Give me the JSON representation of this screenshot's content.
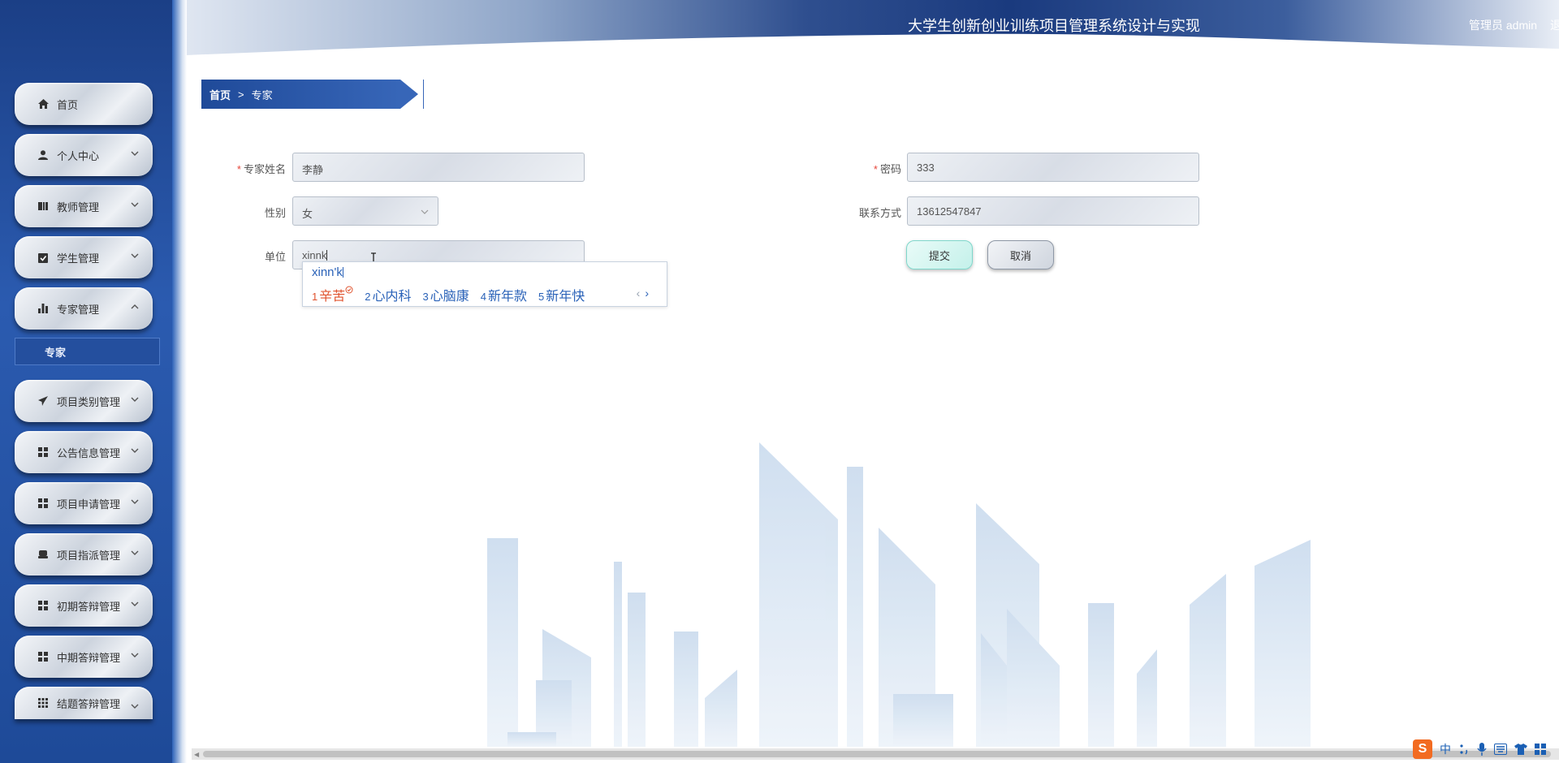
{
  "header": {
    "title": "大学生创新创业训练项目管理系统设计与实现",
    "admin_label": "管理员 admin",
    "logout": "退出登录"
  },
  "sidebar": {
    "items": [
      {
        "label": "首页",
        "icon": "home-icon",
        "chevron": false
      },
      {
        "label": "个人中心",
        "icon": "user-icon",
        "chevron": "down"
      },
      {
        "label": "教师管理",
        "icon": "book-icon",
        "chevron": "down"
      },
      {
        "label": "学生管理",
        "icon": "clipboard-check-icon",
        "chevron": "down"
      },
      {
        "label": "专家管理",
        "icon": "bar-chart-icon",
        "chevron": "up"
      },
      {
        "label": "项目类别管理",
        "icon": "paper-plane-icon",
        "chevron": "down"
      },
      {
        "label": "公告信息管理",
        "icon": "grid-icon",
        "chevron": "down"
      },
      {
        "label": "项目申请管理",
        "icon": "grid-icon",
        "chevron": "down"
      },
      {
        "label": "项目指派管理",
        "icon": "inbox-icon",
        "chevron": "down"
      },
      {
        "label": "初期答辩管理",
        "icon": "grid-icon",
        "chevron": "down"
      },
      {
        "label": "中期答辩管理",
        "icon": "grid-icon",
        "chevron": "down"
      },
      {
        "label": "结题答辩管理",
        "icon": "grid-9-icon",
        "chevron": "down"
      }
    ],
    "sub_item": "专家"
  },
  "breadcrumb": {
    "home": "首页",
    "separator": ">",
    "current": "专家"
  },
  "form": {
    "name_label": "专家姓名",
    "name_value": "李静",
    "password_label": "密码",
    "password_value": "333",
    "gender_label": "性别",
    "gender_value": "女",
    "phone_label": "联系方式",
    "phone_value": "13612547847",
    "unit_label": "单位",
    "unit_value": "xinnk",
    "required_mark": "*",
    "submit_label": "提交",
    "cancel_label": "取消"
  },
  "ime": {
    "input": "xinn'k",
    "candidates": [
      {
        "num": "1",
        "text": "辛苦"
      },
      {
        "num": "2",
        "text": "心内科"
      },
      {
        "num": "3",
        "text": "心脑康"
      },
      {
        "num": "4",
        "text": "新年款"
      },
      {
        "num": "5",
        "text": "新年快"
      }
    ],
    "prev": "‹",
    "next": "›"
  },
  "tray": {
    "logo": "S",
    "lang": "中"
  },
  "colors": {
    "sidebar": "#1e4a98",
    "header_dark": "#1c3f85",
    "accent_red": "#e6463b",
    "candidate_blue": "#2a62b8",
    "candidate_first": "#e0532e"
  }
}
